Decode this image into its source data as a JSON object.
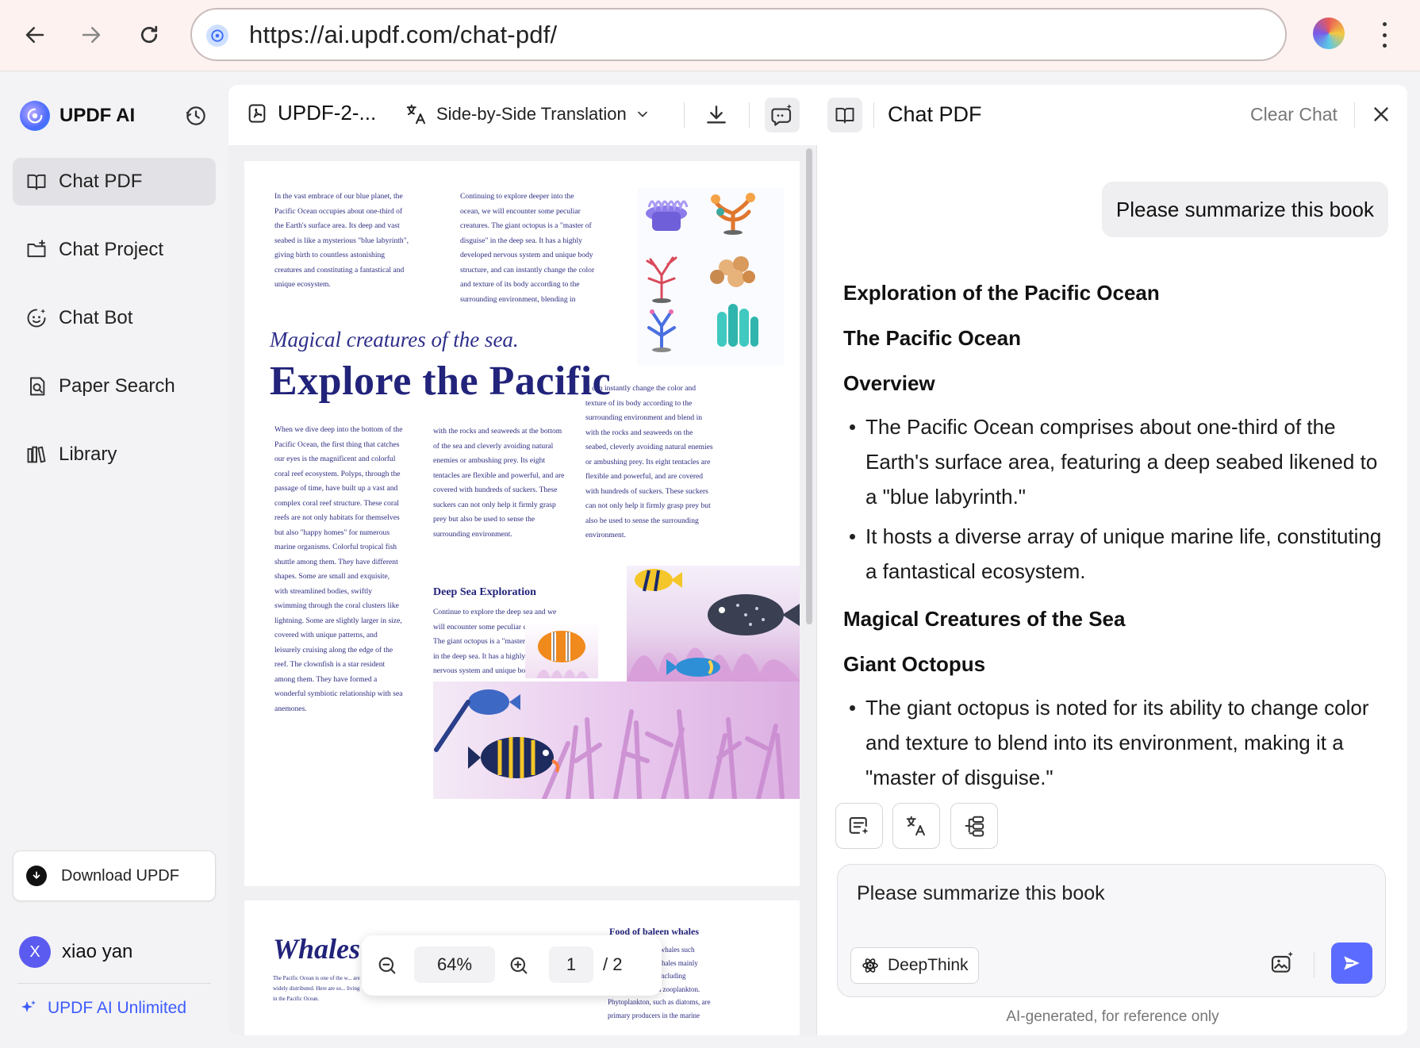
{
  "browser": {
    "url": "https://ai.updf.com/chat-pdf/"
  },
  "sidebar": {
    "brand": "UPDF AI",
    "items": [
      {
        "label": "Chat PDF",
        "icon": "book-open-icon",
        "active": true
      },
      {
        "label": "Chat Project",
        "icon": "folder-plus-icon"
      },
      {
        "label": "Chat Bot",
        "icon": "bot-icon"
      },
      {
        "label": "Paper Search",
        "icon": "doc-search-icon"
      },
      {
        "label": "Library",
        "icon": "library-icon"
      }
    ],
    "download_label": "Download UPDF",
    "user_name": "xiao yan",
    "user_initial": "X",
    "unlimited_label": "UPDF AI Unlimited"
  },
  "pdf": {
    "file_name": "UPDF-2-...",
    "translation_label": "Side-by-Side Translation",
    "zoom": "64%",
    "page_current": "1",
    "page_total": "/ 2",
    "page1": {
      "col1_top": "In the vast embrace of our blue planet, the Pacific Ocean occupies about one-third of the Earth's surface area. Its deep and vast seabed is like a mysterious \"blue labyrinth\", giving birth to countless astonishing creatures and constituting a fantastical and unique ecosystem.",
      "col2_top": "Continuing to explore deeper into the ocean, we will encounter some peculiar creatures. The giant octopus is a \"master of disguise\" in the deep sea. It has a highly developed nervous system and unique body structure, and can instantly change the color and texture of its body according to the surrounding environment, blending in",
      "subtitle": "Magical creatures of the sea.",
      "title": "Explore the Pacific",
      "col3_mid": "It can instantly change the color and texture of its body according to the surrounding environment and blend in with the rocks and seaweeds on the seabed, cleverly avoiding natural enemies or ambushing prey. Its eight tentacles are flexible and powerful, and are covered with hundreds of suckers. These suckers can not only help it firmly grasp prey but also be used to sense the surrounding environment.",
      "col1_bottom": "When we dive deep into the bottom of the Pacific Ocean, the first thing that catches our eyes is the magnificent and colorful coral reef ecosystem. Polyps, through the passage of time, have built up a vast and complex coral reef structure. These coral reefs are not only habitats for themselves but also \"happy homes\" for numerous marine organisms. Colorful tropical fish shuttle among them. They have different shapes. Some are small and exquisite, with streamlined bodies, swiftly swimming through the coral clusters like lightning. Some are slightly larger in size, covered with unique patterns, and leisurely cruising along the edge of the reef. The clownfish is a star resident among them. They have formed a wonderful symbiotic relationship with sea anemones.",
      "col2_bottom": "with the rocks and seaweeds at the bottom of the sea and cleverly avoiding natural enemies or ambushing prey. Its eight tentacles are flexible and powerful, and are covered with hundreds of suckers. These suckers can not only help it firmly grasp prey but also be used to sense the surrounding environment.",
      "deep_heading": "Deep Sea Exploration",
      "deep_text": "Continue to explore the deep sea and we will encounter some peculiar creatures. The giant octopus is a \"master of disguise\" in the deep sea. It has a highly developed nervous system and unique body structure."
    },
    "page2": {
      "title": "Whales",
      "intro": "The Pacific Ocean is one of the w... are widely distributed. Here are so... living in the Pacific Ocean.",
      "food_heading": "Food of baleen whales",
      "food_text": "...lankton: Baleen whales such ...whales and fin whales mainly ...small plankton, including phytoplankton and zooplankton. Phytoplankton, such as diatoms, are primary producers in the marine"
    }
  },
  "chat": {
    "title": "Chat PDF",
    "clear_label": "Clear Chat",
    "user_message": "Please summarize this book",
    "answer": {
      "h1": "Exploration of the Pacific Ocean",
      "h2": "The Pacific Ocean",
      "h3": "Overview",
      "overview_bullets": [
        "The Pacific Ocean comprises about one-third of the Earth's surface area, featuring a deep seabed likened to a \"blue labyrinth.\"",
        "It hosts a diverse array of unique marine life, constituting a fantastical ecosystem."
      ],
      "h4": "Magical Creatures of the Sea",
      "h5": "Giant Octopus",
      "octopus_bullets": [
        "The giant octopus is noted for its ability to change color and texture to blend into its environment, making it a \"master of disguise.\""
      ]
    },
    "input_value": "Please summarize this book",
    "deepthink_label": "DeepThink",
    "disclaimer": "AI-generated, for reference only"
  },
  "colors": {
    "accent": "#5b6bff",
    "pdf_navy": "#22237a",
    "unlimited": "#3d5cff"
  }
}
